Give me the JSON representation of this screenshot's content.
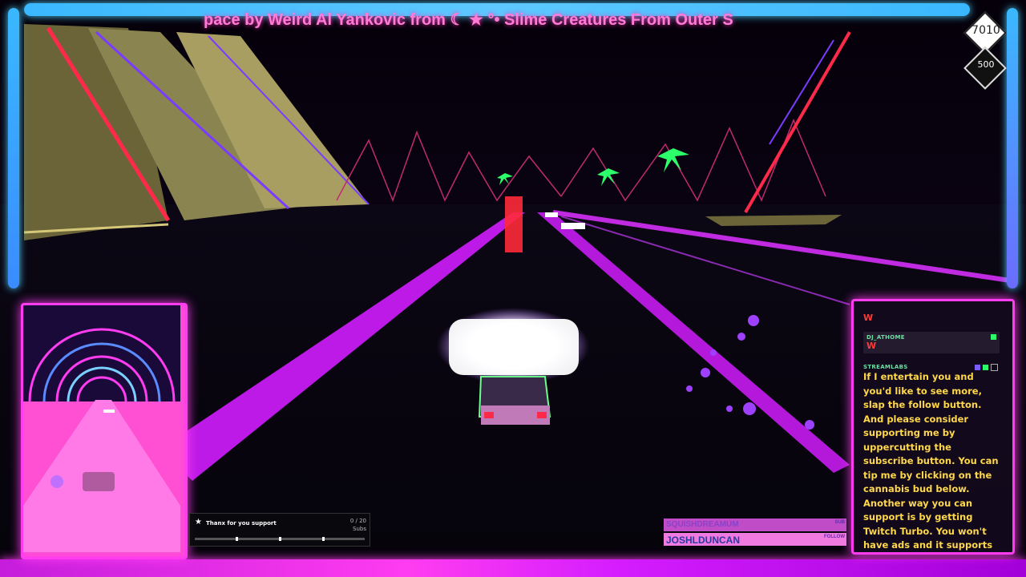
{
  "ticker": {
    "text": "pace by Weird Al Yankovic from ☾ ★ °• Slime Creatures From Outer S"
  },
  "score": {
    "top": "7010",
    "bottom": "500"
  },
  "chat": {
    "messages": [
      {
        "user": "",
        "text": "W"
      },
      {
        "user": "DJ_ATHOME",
        "text": "W"
      },
      {
        "user": "STREAMLABS",
        "text": "If I entertain you and you'd like to see more, slap the follow button. And please consider supporting me by uppercutting the subscribe button. You can tip me by clicking on the cannabis bud below. Another way you can support is by getting Twitch Turbo. You won't have ads and it supports the streamer more than a subscription will"
      }
    ]
  },
  "subs_goal": {
    "label": "Thanx for you support",
    "count": "0 / 20",
    "unit": "Subs",
    "progress": 0
  },
  "follow_alerts": [
    {
      "name": "SQUISHDREAMUM",
      "tag": "SUB"
    },
    {
      "name": "JOSHLDUNCAN",
      "tag": "FOLLOW"
    }
  ],
  "colors": {
    "neon_pink": "#ff3cf0",
    "neon_blue": "#4fd0ff",
    "road_magenta": "#d21dff",
    "chat_text": "#ffd84a"
  }
}
